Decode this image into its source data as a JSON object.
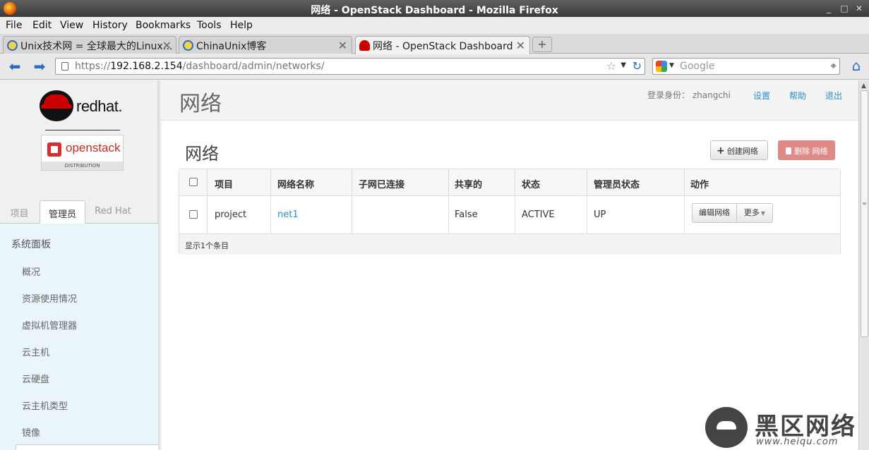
{
  "window": {
    "title": "网络 - OpenStack Dashboard - Mozilla Firefox",
    "minimize": "_",
    "maximize": "□",
    "close": "✕"
  },
  "menu": [
    "File",
    "Edit",
    "View",
    "History",
    "Bookmarks",
    "Tools",
    "Help"
  ],
  "tabs": [
    {
      "label": "Unix技术网 = 全球最大的Linux…",
      "icon": "chinaunix-icon"
    },
    {
      "label": "ChinaUnix博客",
      "icon": "chinaunix-icon"
    },
    {
      "label": "网络 - OpenStack Dashboard",
      "icon": "redhat-icon",
      "active": true
    }
  ],
  "browser": {
    "url_scheme": "https://",
    "url_host": "192.168.2.154",
    "url_path": "/dashboard/admin/networks/",
    "search_placeholder": "Google",
    "new_tab": "+",
    "tab_close": "✕"
  },
  "sidebar": {
    "brand": "redhat",
    "brand_mark": ".",
    "openstack_brand": "openstack",
    "distribution": "DISTRIBUTION",
    "tabs": [
      "项目",
      "管理员",
      "Red Hat"
    ],
    "active_tab": 1,
    "panel_title": "系统面板",
    "items": [
      "概况",
      "资源使用情况",
      "虚拟机管理器",
      "云主机",
      "云硬盘",
      "云主机类型",
      "镜像"
    ]
  },
  "header": {
    "title": "网络",
    "user_label": "登录身份：",
    "username": "zhangchi",
    "links": [
      "设置",
      "帮助",
      "退出"
    ]
  },
  "main": {
    "section_title": "网络",
    "create_button": "创建网络",
    "delete_button": "删除 网络",
    "table": {
      "headers": [
        "项目",
        "网络名称",
        "子网已连接",
        "共享的",
        "状态",
        "管理员状态",
        "动作"
      ],
      "rows": [
        {
          "project": "project",
          "name": "net1",
          "subnets": "",
          "shared": "False",
          "status": "ACTIVE",
          "admin_state": "UP",
          "action_primary": "编辑网络",
          "action_more": "更多"
        }
      ],
      "footer": "显示1个条目"
    }
  },
  "watermark": {
    "text": "黑区网络",
    "url": "www.heiqu.com"
  },
  "colors": {
    "link": "#2a8fc7",
    "danger": "#df8a86",
    "panel_bg": "#e9f5fb",
    "redhat": "#cc0000"
  }
}
